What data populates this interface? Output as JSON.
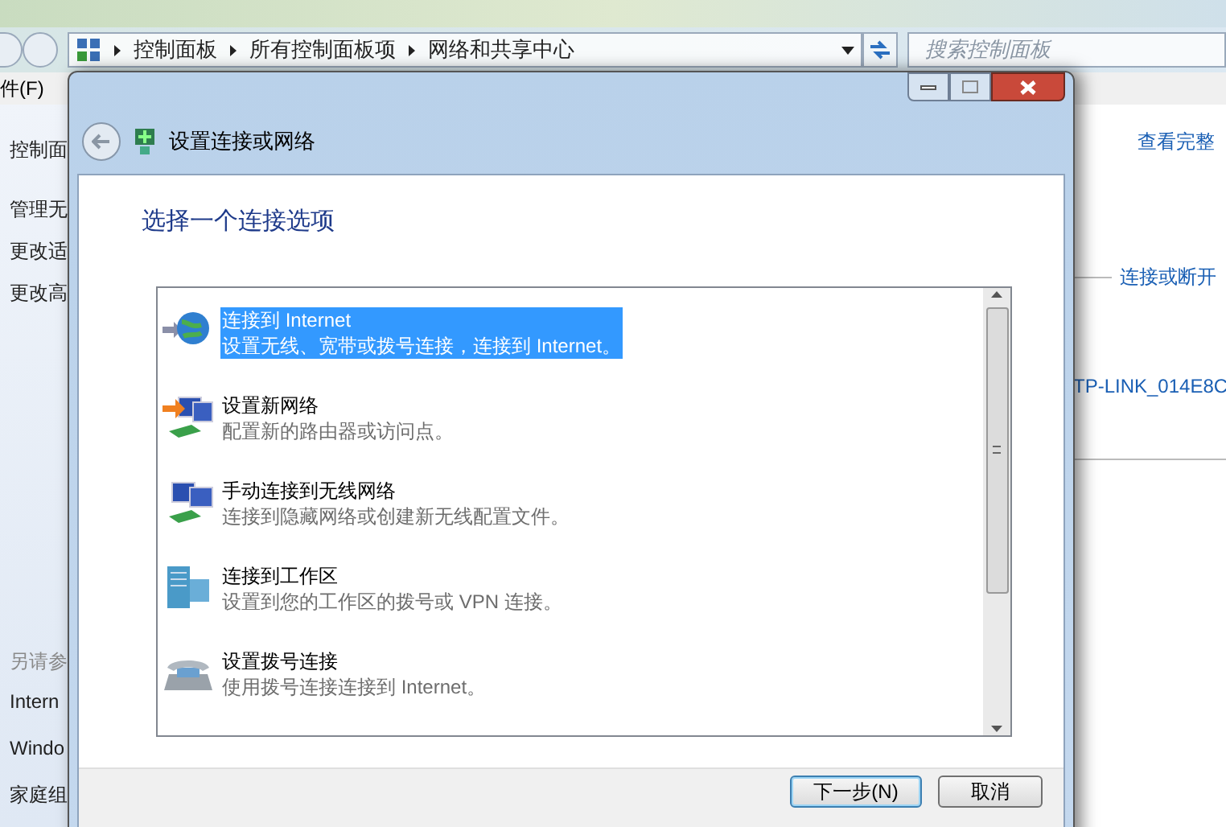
{
  "explorer": {
    "breadcrumb": [
      "控制面板",
      "所有控制面板项",
      "网络和共享中心"
    ],
    "search": {
      "placeholder": "搜索控制面板"
    },
    "menu": [
      "件(F)"
    ],
    "left_pane": {
      "title": "控制面",
      "links": [
        "管理无",
        "更改适",
        "更改高"
      ],
      "see_also_heading": "另请参",
      "see_also": [
        "Intern",
        "Windo",
        "家庭组"
      ]
    },
    "right_links": [
      "查看完整",
      "连接或断开",
      "TP-LINK_014E8C"
    ]
  },
  "dialog": {
    "title": "设置连接或网络",
    "heading": "选择一个连接选项",
    "options": [
      {
        "kind": "globe",
        "title": "连接到 Internet",
        "description": "设置无线、宽带或拨号连接，连接到 Internet。",
        "selected": true
      },
      {
        "kind": "router",
        "title": "设置新网络",
        "description": "配置新的路由器或访问点。",
        "selected": false
      },
      {
        "kind": "wireless",
        "title": "手动连接到无线网络",
        "description": "连接到隐藏网络或创建新无线配置文件。",
        "selected": false
      },
      {
        "kind": "workplace",
        "title": "连接到工作区",
        "description": "设置到您的工作区的拨号或 VPN 连接。",
        "selected": false
      },
      {
        "kind": "phone",
        "title": "设置拨号连接",
        "description": "使用拨号连接连接到 Internet。",
        "selected": false
      }
    ],
    "buttons": [
      {
        "label": "下一步(N)",
        "default": true
      },
      {
        "label": "取消",
        "default": false
      }
    ]
  }
}
